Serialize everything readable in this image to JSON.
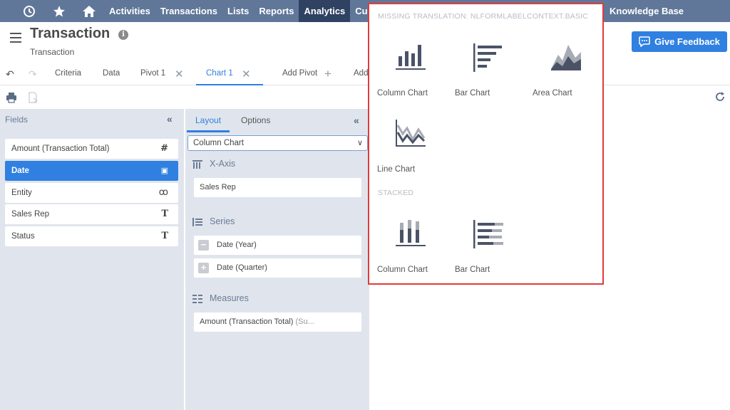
{
  "nav": {
    "items": [
      {
        "label": "Activities",
        "active": false
      },
      {
        "label": "Transactions",
        "active": false
      },
      {
        "label": "Lists",
        "active": false
      },
      {
        "label": "Reports",
        "active": false
      },
      {
        "label": "Analytics",
        "active": true
      },
      {
        "label": "Custo",
        "active": false
      }
    ],
    "knowledge_base": "Knowledge Base"
  },
  "header": {
    "title": "Transaction",
    "subtitle": "Transaction",
    "feedback_label": "Give Feedback"
  },
  "tabs": [
    {
      "label": "Criteria"
    },
    {
      "label": "Data"
    },
    {
      "label": "Pivot 1"
    },
    {
      "label": "Chart 1"
    },
    {
      "label": "Add Pivot"
    },
    {
      "label": "Add"
    }
  ],
  "fields_panel": {
    "title": "Fields",
    "items": [
      {
        "label": "Amount (Transaction Total)",
        "type_glyph": "#",
        "selected": false
      },
      {
        "label": "Date",
        "type_glyph": "▣",
        "selected": true
      },
      {
        "label": "Entity",
        "type_glyph": "ꝏ",
        "selected": false
      },
      {
        "label": "Sales Rep",
        "type_glyph": "T",
        "selected": false
      },
      {
        "label": "Status",
        "type_glyph": "T",
        "selected": false
      }
    ]
  },
  "layout_panel": {
    "tabs": [
      {
        "label": "Layout"
      },
      {
        "label": "Options"
      }
    ],
    "chart_type_value": "Column Chart",
    "xaxis": {
      "title": "X-Axis",
      "items": [
        "Sales Rep"
      ]
    },
    "series": {
      "title": "Series",
      "items": [
        {
          "label": "Date (Year)",
          "toggle": "−"
        },
        {
          "label": "Date (Quarter)",
          "toggle": "+"
        }
      ]
    },
    "measures": {
      "title": "Measures",
      "items": [
        {
          "label": "Amount (Transaction Total)",
          "agg": " (Su..."
        }
      ]
    }
  },
  "chart_menu": {
    "basic_header": "MISSING TRANSLATION: NLFORMLABELCONTEXT.BASIC",
    "basic": [
      "Column Chart",
      "Bar Chart",
      "Area Chart",
      "Line Chart"
    ],
    "stacked_header": "STACKED",
    "stacked": [
      "Column Chart",
      "Bar Chart"
    ]
  },
  "colors": {
    "nav_bg": "#607799",
    "nav_active": "#2f4262",
    "accent": "#2f80e0",
    "panel_bg": "#e0e5ed",
    "menu_border": "#e23b3b",
    "icon_dark": "#4a5366"
  }
}
